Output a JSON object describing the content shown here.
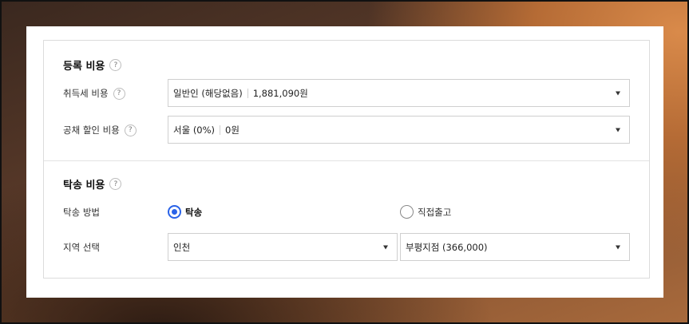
{
  "registration": {
    "title": "등록 비용",
    "help": "?",
    "acquisition_tax": {
      "label": "취득세 비용",
      "help": "?",
      "selected_type": "일반인 (해당없음)",
      "amount": "1,881,090원"
    },
    "bond_discount": {
      "label": "공채 할인 비용",
      "help": "?",
      "selected_region": "서울 (0%)",
      "amount": "0원"
    }
  },
  "transport": {
    "title": "탁송 비용",
    "help": "?",
    "method": {
      "label": "탁송 방법",
      "options": [
        {
          "label": "탁송",
          "checked": true
        },
        {
          "label": "직접출고",
          "checked": false
        }
      ]
    },
    "region": {
      "label": "지역 선택",
      "city": "인천",
      "branch": "부평지점 (366,000)"
    }
  },
  "colors": {
    "accent": "#2a63e8"
  }
}
